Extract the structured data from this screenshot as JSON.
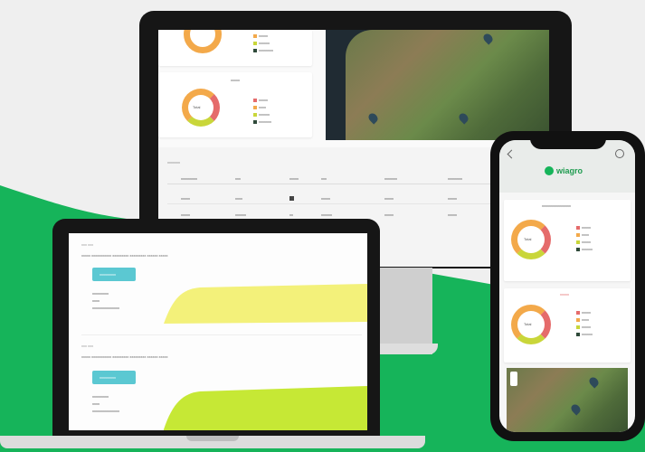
{
  "brand": {
    "name": "wiagro",
    "accent": "#16b45a",
    "teal": "#5bc8d2",
    "yellow": "#f3f17a",
    "lime": "#c6e835"
  },
  "monitor": {
    "legend_top": [
      "xxxxx",
      "xxxxxx",
      "xxxxxxxx"
    ],
    "card2_title": "xxxxx",
    "donut_label": "Total",
    "legend_bottom": [
      "xxxxx",
      "xxxx",
      "xxxxxx",
      "xxxxxxx"
    ],
    "table_title": "xxxxxxx",
    "table_headers": [
      "",
      "xxxxxxxxx",
      "xxx",
      "xxxxx",
      "xxx",
      "xxxxxxx",
      "xxxxxxxx"
    ],
    "table_rows": [
      [
        "",
        "xxxxx",
        "xxxx",
        "xx",
        "xxxxx",
        "xxxxx",
        "xxxxx"
      ],
      [
        "",
        "xxxxx",
        "xxxxxx",
        "xx",
        "xxxxxx",
        "xxxxx",
        "xxxxx"
      ]
    ]
  },
  "laptop": {
    "section1_title": "xxx xxx",
    "section1_text": "xxxxx xxxxxxxxxxx xxxxxxxxx xxxxxxxxx xxxxxx xxxxx",
    "section1_button": "xxxxxxxxx",
    "section1_labels": [
      "xxxxxxxxx",
      "xxxx",
      "xxxxxxxxxxxxxxx"
    ],
    "section2_title": "xxx xxx",
    "section2_text": "xxxxx xxxxxxxxxxx xxxxxxxxx xxxxxxxxx xxxxxx xxxxx",
    "section2_button": "xxxxxxxxx",
    "section2_labels": [
      "xxxxxxxxx",
      "xxxx",
      "xxxxxxxxxxxxxxx"
    ]
  },
  "phone": {
    "logo": "wiagro",
    "card1_title": "xxxxxxxxxxxxxxxx",
    "donut1_label": "Total",
    "legend1": [
      "xxxxx",
      "xxxx",
      "xxxxx",
      "xxxxxx"
    ],
    "card2_title": "xxxxx",
    "donut2_label": "Total",
    "legend2": [
      "xxxxx",
      "xxxx",
      "xxxxx",
      "xxxxxx"
    ]
  }
}
